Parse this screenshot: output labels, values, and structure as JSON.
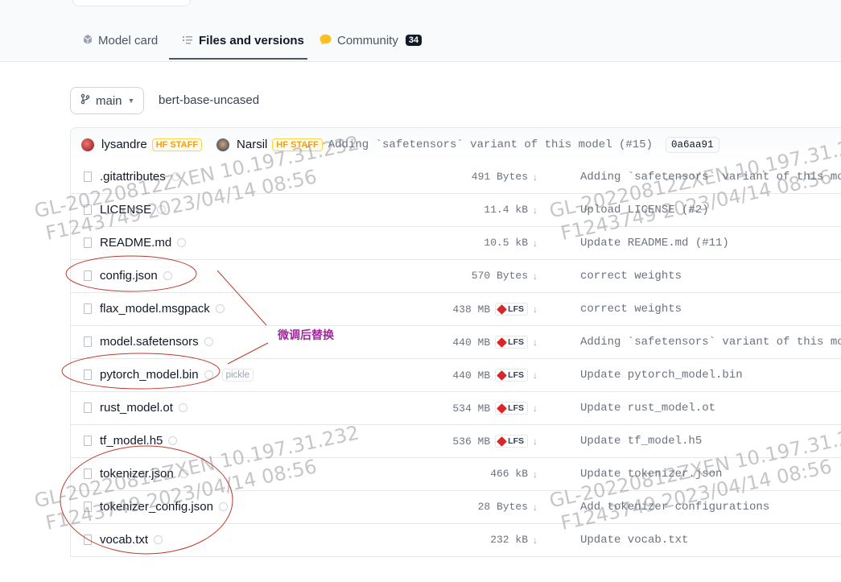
{
  "tabs": [
    {
      "label": "Model card",
      "icon": "cube-icon"
    },
    {
      "label": "Files and versions",
      "icon": "list-icon",
      "active": true
    },
    {
      "label": "Community",
      "icon": "chat-bubble-icon",
      "badge": "34"
    }
  ],
  "branch": {
    "label": "main",
    "icon": "branch-icon"
  },
  "repo_name": "bert-base-uncased",
  "commit": {
    "author1": "lysandre",
    "author1_badge": "HF STAFF",
    "author2": "Narsil",
    "author2_badge": "HF STAFF",
    "message": "Adding `safetensors` variant of this model (#15)",
    "hash": "0a6aa91"
  },
  "files": [
    {
      "name": ".gitattributes",
      "size": "491 Bytes",
      "lfs": false,
      "message": "Adding `safetensors` variant of this mo"
    },
    {
      "name": "LICENSE",
      "size": "11.4 kB",
      "lfs": false,
      "message": "Upload LICENSE (#2)"
    },
    {
      "name": "README.md",
      "size": "10.5 kB",
      "lfs": false,
      "message": "Update README.md (#11)"
    },
    {
      "name": "config.json",
      "size": "570 Bytes",
      "lfs": false,
      "message": "correct weights"
    },
    {
      "name": "flax_model.msgpack",
      "size": "438 MB",
      "lfs": true,
      "message": "correct weights"
    },
    {
      "name": "model.safetensors",
      "size": "440 MB",
      "lfs": true,
      "message": "Adding `safetensors` variant of this mo"
    },
    {
      "name": "pytorch_model.bin",
      "size": "440 MB",
      "lfs": true,
      "message": "Update pytorch_model.bin",
      "tag": "pickle"
    },
    {
      "name": "rust_model.ot",
      "size": "534 MB",
      "lfs": true,
      "message": "Update rust_model.ot"
    },
    {
      "name": "tf_model.h5",
      "size": "536 MB",
      "lfs": true,
      "message": "Update tf_model.h5"
    },
    {
      "name": "tokenizer.json",
      "size": "466 kB",
      "lfs": false,
      "message": "Update tokenizer.json"
    },
    {
      "name": "tokenizer_config.json",
      "size": "28 Bytes",
      "lfs": false,
      "message": "Add tokenizer configurations"
    },
    {
      "name": "vocab.txt",
      "size": "232 kB",
      "lfs": false,
      "message": "Update vocab.txt"
    }
  ],
  "lfs_label": "LFS",
  "annotation_note": "微调后替换",
  "watermark": {
    "line1": "GL-20220812ZXEN  10.197.31.232",
    "line2": "F1243749 2023/04/14 08:56"
  },
  "colors": {
    "accent": "#4b5563",
    "annotation": "#c0392b",
    "note": "#a0289a",
    "staff": "#f59e0b",
    "lfs": "#dc2626"
  }
}
